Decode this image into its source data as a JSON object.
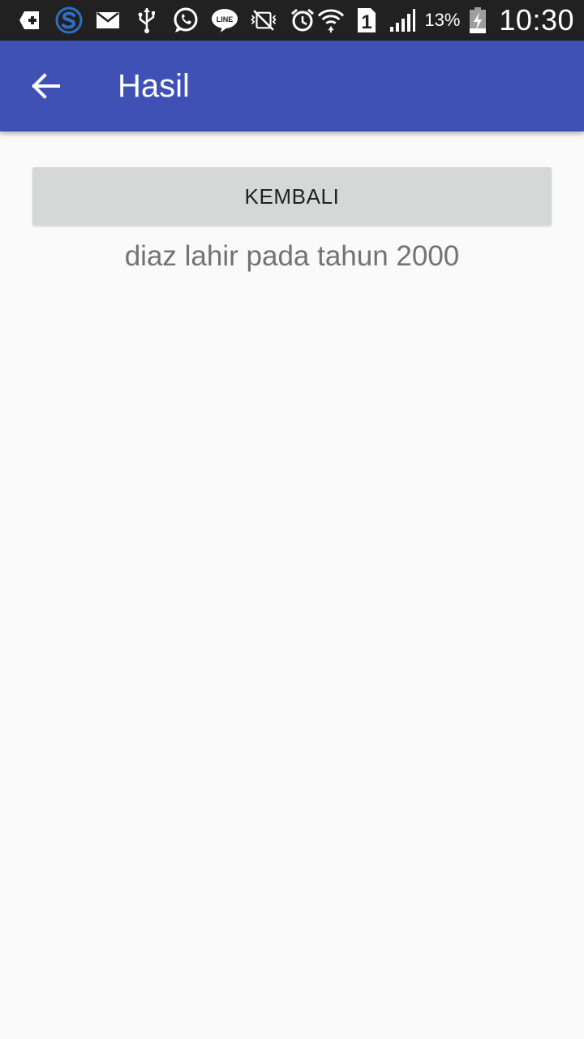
{
  "status_bar": {
    "icons": [
      "add-box-icon",
      "s-app-icon",
      "mail-icon",
      "usb-icon",
      "whatsapp-icon",
      "line-app-icon",
      "vibrate-mute-icon",
      "alarm-icon",
      "wifi-icon",
      "sim-1-icon",
      "signal-icon",
      "battery-icon"
    ],
    "sim_label": "1",
    "line_label": "LINE",
    "battery_percent": "13%",
    "time": "10:30"
  },
  "app_bar": {
    "title": "Hasil",
    "color": "#3f51b5"
  },
  "main": {
    "button_label": "KEMBALI",
    "result_text": "diaz lahir pada tahun 2000"
  }
}
